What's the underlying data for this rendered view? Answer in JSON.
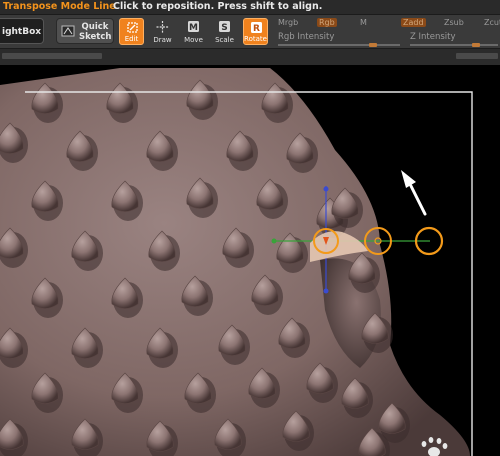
{
  "status_bar": {
    "mode": "Transpose Mode Line",
    "message": "Click to reposition. Press shift to align."
  },
  "toolbar": {
    "lightbox_label": "ightBox",
    "quick_sketch_label": "Quick Sketch",
    "tools": [
      {
        "name": "edit",
        "label": "Edit",
        "active": true
      },
      {
        "name": "draw",
        "label": "Draw",
        "active": false
      },
      {
        "name": "move",
        "label": "Move",
        "active": false
      },
      {
        "name": "scale",
        "label": "Scale",
        "active": false
      },
      {
        "name": "rotate",
        "label": "Rotate",
        "active": true
      }
    ],
    "channels": {
      "mrgb": "Mrgb",
      "rgb": "Rgb",
      "m": "M",
      "zadd": "Zadd",
      "zsub": "Zsub",
      "zcut": "Zcut"
    },
    "sliders": {
      "rgb_intensity_label": "Rgb Intensity",
      "z_intensity_label": "Z Intensity",
      "rgb_intensity_value": 0.78,
      "z_intensity_value": 0.75
    }
  },
  "colors": {
    "accent": "#f0821e",
    "status_mode": "#f3931c",
    "mesh": "#8a7270",
    "transpose_orange": "#f39a1a",
    "axis_green": "#3aa33a",
    "axis_blue": "#3a4bd0"
  }
}
